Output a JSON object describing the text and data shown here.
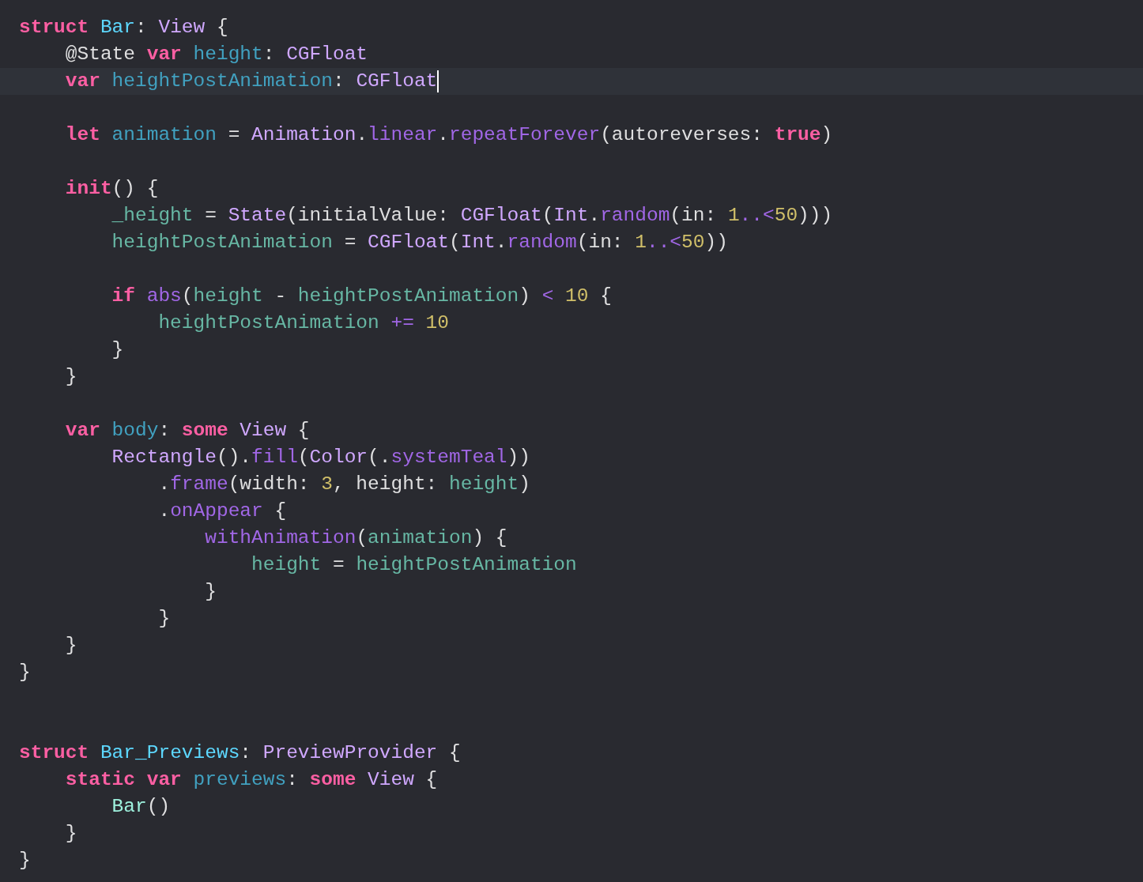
{
  "editor": {
    "lines": [
      {
        "kind": "code",
        "current": false,
        "tokens": [
          {
            "text": "struct ",
            "kind": "keyword"
          },
          {
            "text": "Bar",
            "kind": "type-declaration"
          },
          {
            "text": ": ",
            "kind": "plain"
          },
          {
            "text": "View",
            "kind": "type"
          },
          {
            "text": " {",
            "kind": "plain"
          }
        ]
      },
      {
        "kind": "code",
        "current": false,
        "tokens": [
          {
            "text": "    @State ",
            "kind": "plain"
          },
          {
            "text": "var ",
            "kind": "keyword"
          },
          {
            "text": "height",
            "kind": "declaration"
          },
          {
            "text": ": ",
            "kind": "plain"
          },
          {
            "text": "CGFloat",
            "kind": "type"
          }
        ]
      },
      {
        "kind": "code",
        "current": true,
        "tokens": [
          {
            "text": "    var ",
            "kind": "keyword"
          },
          {
            "text": "heightPostAnimation",
            "kind": "declaration"
          },
          {
            "text": ": ",
            "kind": "plain"
          },
          {
            "text": "CGFloat",
            "kind": "type"
          }
        ]
      },
      {
        "kind": "blank"
      },
      {
        "kind": "code",
        "current": false,
        "tokens": [
          {
            "text": "    let ",
            "kind": "keyword"
          },
          {
            "text": "animation",
            "kind": "declaration"
          },
          {
            "text": " = ",
            "kind": "plain"
          },
          {
            "text": "Animation",
            "kind": "type"
          },
          {
            "text": ".",
            "kind": "plain"
          },
          {
            "text": "linear",
            "kind": "function"
          },
          {
            "text": ".",
            "kind": "plain"
          },
          {
            "text": "repeatForever",
            "kind": "function"
          },
          {
            "text": "(autoreverses: ",
            "kind": "plain"
          },
          {
            "text": "true",
            "kind": "keyword"
          },
          {
            "text": ")",
            "kind": "plain"
          }
        ]
      },
      {
        "kind": "blank"
      },
      {
        "kind": "code",
        "current": false,
        "tokens": [
          {
            "text": "    init",
            "kind": "keyword"
          },
          {
            "text": "() {",
            "kind": "plain"
          }
        ]
      },
      {
        "kind": "code",
        "current": false,
        "tokens": [
          {
            "text": "        _height",
            "kind": "member"
          },
          {
            "text": " = ",
            "kind": "plain"
          },
          {
            "text": "State",
            "kind": "type"
          },
          {
            "text": "(initialValue: ",
            "kind": "plain"
          },
          {
            "text": "CGFloat",
            "kind": "type"
          },
          {
            "text": "(",
            "kind": "plain"
          },
          {
            "text": "Int",
            "kind": "type"
          },
          {
            "text": ".",
            "kind": "plain"
          },
          {
            "text": "random",
            "kind": "function"
          },
          {
            "text": "(in: ",
            "kind": "plain"
          },
          {
            "text": "1",
            "kind": "number"
          },
          {
            "text": "..<",
            "kind": "function"
          },
          {
            "text": "50",
            "kind": "number"
          },
          {
            "text": ")))",
            "kind": "plain"
          }
        ]
      },
      {
        "kind": "code",
        "current": false,
        "tokens": [
          {
            "text": "        heightPostAnimation",
            "kind": "member"
          },
          {
            "text": " = ",
            "kind": "plain"
          },
          {
            "text": "CGFloat",
            "kind": "type"
          },
          {
            "text": "(",
            "kind": "plain"
          },
          {
            "text": "Int",
            "kind": "type"
          },
          {
            "text": ".",
            "kind": "plain"
          },
          {
            "text": "random",
            "kind": "function"
          },
          {
            "text": "(in: ",
            "kind": "plain"
          },
          {
            "text": "1",
            "kind": "number"
          },
          {
            "text": "..<",
            "kind": "function"
          },
          {
            "text": "50",
            "kind": "number"
          },
          {
            "text": "))",
            "kind": "plain"
          }
        ]
      },
      {
        "kind": "blank"
      },
      {
        "kind": "code",
        "current": false,
        "tokens": [
          {
            "text": "        if ",
            "kind": "keyword"
          },
          {
            "text": "abs",
            "kind": "function"
          },
          {
            "text": "(",
            "kind": "plain"
          },
          {
            "text": "height",
            "kind": "member"
          },
          {
            "text": " - ",
            "kind": "plain"
          },
          {
            "text": "heightPostAnimation",
            "kind": "member"
          },
          {
            "text": ") ",
            "kind": "plain"
          },
          {
            "text": "< ",
            "kind": "function"
          },
          {
            "text": "10",
            "kind": "number"
          },
          {
            "text": " {",
            "kind": "plain"
          }
        ]
      },
      {
        "kind": "code",
        "current": false,
        "tokens": [
          {
            "text": "            heightPostAnimation ",
            "kind": "member"
          },
          {
            "text": "+= ",
            "kind": "function"
          },
          {
            "text": "10",
            "kind": "number"
          }
        ]
      },
      {
        "kind": "code",
        "current": false,
        "tokens": [
          {
            "text": "        }",
            "kind": "plain"
          }
        ]
      },
      {
        "kind": "code",
        "current": false,
        "tokens": [
          {
            "text": "    }",
            "kind": "plain"
          }
        ]
      },
      {
        "kind": "blank"
      },
      {
        "kind": "code",
        "current": false,
        "tokens": [
          {
            "text": "    var ",
            "kind": "keyword"
          },
          {
            "text": "body",
            "kind": "declaration"
          },
          {
            "text": ": ",
            "kind": "plain"
          },
          {
            "text": "some ",
            "kind": "keyword"
          },
          {
            "text": "View",
            "kind": "type"
          },
          {
            "text": " {",
            "kind": "plain"
          }
        ]
      },
      {
        "kind": "code",
        "current": false,
        "tokens": [
          {
            "text": "        Rectangle",
            "kind": "type"
          },
          {
            "text": "().",
            "kind": "plain"
          },
          {
            "text": "fill",
            "kind": "function"
          },
          {
            "text": "(",
            "kind": "plain"
          },
          {
            "text": "Color",
            "kind": "type"
          },
          {
            "text": "(.",
            "kind": "plain"
          },
          {
            "text": "systemTeal",
            "kind": "function"
          },
          {
            "text": "))",
            "kind": "plain"
          }
        ]
      },
      {
        "kind": "code",
        "current": false,
        "tokens": [
          {
            "text": "            .",
            "kind": "plain"
          },
          {
            "text": "frame",
            "kind": "function"
          },
          {
            "text": "(width: ",
            "kind": "plain"
          },
          {
            "text": "3",
            "kind": "number"
          },
          {
            "text": ", height: ",
            "kind": "plain"
          },
          {
            "text": "height",
            "kind": "member"
          },
          {
            "text": ")",
            "kind": "plain"
          }
        ]
      },
      {
        "kind": "code",
        "current": false,
        "tokens": [
          {
            "text": "            .",
            "kind": "plain"
          },
          {
            "text": "onAppear",
            "kind": "function"
          },
          {
            "text": " {",
            "kind": "plain"
          }
        ]
      },
      {
        "kind": "code",
        "current": false,
        "tokens": [
          {
            "text": "                withAnimation",
            "kind": "function"
          },
          {
            "text": "(",
            "kind": "plain"
          },
          {
            "text": "animation",
            "kind": "member"
          },
          {
            "text": ") {",
            "kind": "plain"
          }
        ]
      },
      {
        "kind": "code",
        "current": false,
        "tokens": [
          {
            "text": "                    height",
            "kind": "member"
          },
          {
            "text": " = ",
            "kind": "plain"
          },
          {
            "text": "heightPostAnimation",
            "kind": "member"
          }
        ]
      },
      {
        "kind": "code",
        "current": false,
        "tokens": [
          {
            "text": "                }",
            "kind": "plain"
          }
        ]
      },
      {
        "kind": "code",
        "current": false,
        "tokens": [
          {
            "text": "            }",
            "kind": "plain"
          }
        ]
      },
      {
        "kind": "code",
        "current": false,
        "tokens": [
          {
            "text": "    }",
            "kind": "plain"
          }
        ]
      },
      {
        "kind": "code",
        "current": false,
        "tokens": [
          {
            "text": "}",
            "kind": "plain"
          }
        ]
      },
      {
        "kind": "blank"
      },
      {
        "kind": "blank"
      },
      {
        "kind": "code",
        "current": false,
        "tokens": [
          {
            "text": "struct ",
            "kind": "keyword"
          },
          {
            "text": "Bar_Previews",
            "kind": "type-declaration"
          },
          {
            "text": ": ",
            "kind": "plain"
          },
          {
            "text": "PreviewProvider",
            "kind": "type"
          },
          {
            "text": " {",
            "kind": "plain"
          }
        ]
      },
      {
        "kind": "code",
        "current": false,
        "tokens": [
          {
            "text": "    static var ",
            "kind": "keyword"
          },
          {
            "text": "previews",
            "kind": "declaration"
          },
          {
            "text": ": ",
            "kind": "plain"
          },
          {
            "text": "some ",
            "kind": "keyword"
          },
          {
            "text": "View",
            "kind": "type"
          },
          {
            "text": " {",
            "kind": "plain"
          }
        ]
      },
      {
        "kind": "code",
        "current": false,
        "tokens": [
          {
            "text": "        Bar",
            "kind": "project-type"
          },
          {
            "text": "()",
            "kind": "plain"
          }
        ]
      },
      {
        "kind": "code",
        "current": false,
        "tokens": [
          {
            "text": "    }",
            "kind": "plain"
          }
        ]
      },
      {
        "kind": "code",
        "current": false,
        "tokens": [
          {
            "text": "}",
            "kind": "plain"
          }
        ]
      }
    ]
  }
}
